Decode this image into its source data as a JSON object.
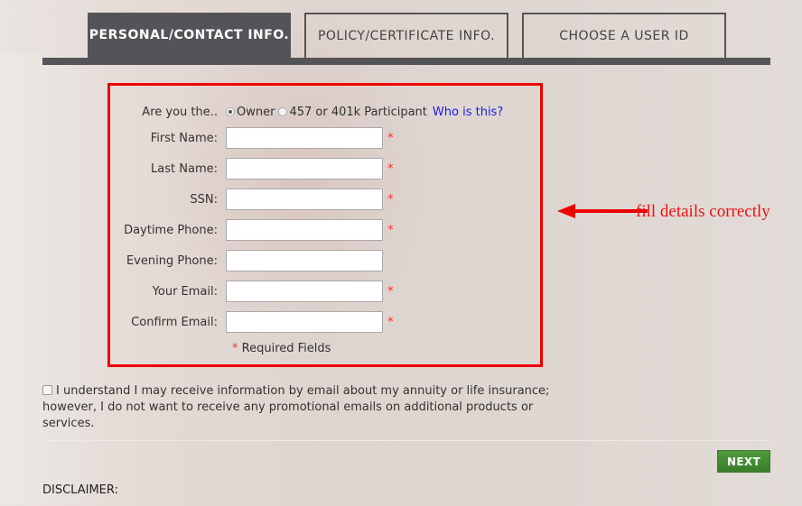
{
  "tabs": [
    {
      "label": "PERSONAL/CONTACT INFO.",
      "active": true
    },
    {
      "label": "POLICY/CERTIFICATE INFO.",
      "active": false
    },
    {
      "label": "CHOOSE A USER ID",
      "active": false
    }
  ],
  "form": {
    "role_question": "Are you the..",
    "role_options": [
      {
        "label": "Owner",
        "selected": true
      },
      {
        "label": "457 or 401k Participant",
        "selected": false
      }
    ],
    "who_link": "Who is this?",
    "fields": [
      {
        "label": "First Name:",
        "value": "",
        "required": true
      },
      {
        "label": "Last Name:",
        "value": "",
        "required": true
      },
      {
        "label": "SSN:",
        "value": "",
        "required": true
      },
      {
        "label": "Daytime Phone:",
        "value": "",
        "required": true
      },
      {
        "label": "Evening Phone:",
        "value": "",
        "required": false
      },
      {
        "label": "Your Email:",
        "value": "",
        "required": true
      },
      {
        "label": "Confirm Email:",
        "value": "",
        "required": true
      }
    ],
    "required_star": "*",
    "required_note": "Required Fields"
  },
  "annotation": {
    "text": "fill details correctly",
    "color": "#ee0000"
  },
  "consent": {
    "checked": false,
    "text": "I understand I may receive information by email about my annuity or life insurance; however, I do not want to receive any promotional emails on additional products or services."
  },
  "next_button": {
    "label": "NEXT",
    "color": "#44902f"
  },
  "disclaimer_label": "DISCLAIMER:"
}
